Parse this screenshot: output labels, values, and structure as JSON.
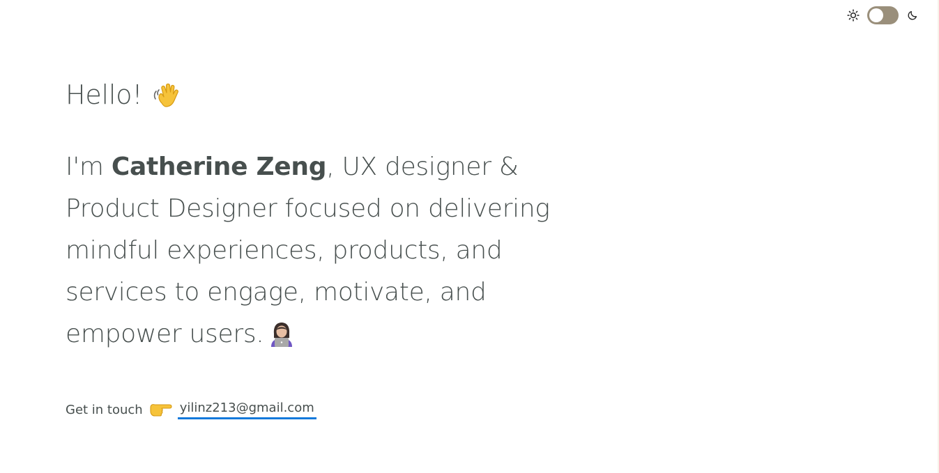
{
  "header": {
    "theme_toggle": {
      "light_icon": "sun-icon",
      "dark_icon": "moon-icon",
      "state": "light"
    }
  },
  "hero": {
    "greeting": "Hello!",
    "greeting_icon": "waving-hand-icon",
    "intro_prefix": "I'm ",
    "name": "Catherine Zeng",
    "intro_rest": ", UX designer & Product Designer focused on delivering mindful experiences, products, and services to engage, motivate, and empower users.",
    "intro_icon": "person-with-laptop-icon"
  },
  "contact": {
    "label": "Get in touch",
    "icon": "pointing-right-icon",
    "email": "yilinz213@gmail.com"
  },
  "colors": {
    "text": "#474f4e",
    "link_underline": "#1379db",
    "toggle_track": "#9a8f7b"
  }
}
